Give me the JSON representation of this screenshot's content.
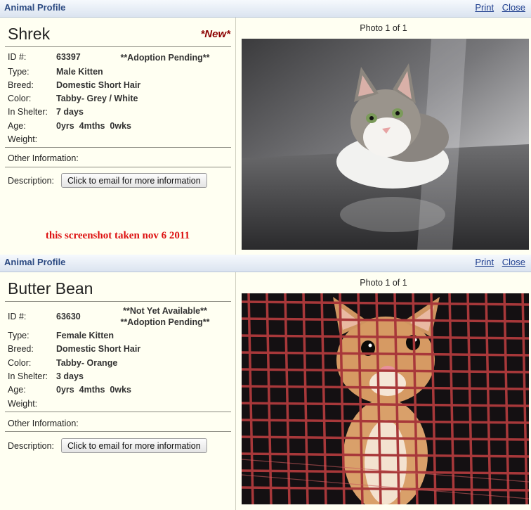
{
  "profiles": [
    {
      "bar": {
        "title": "Animal Profile",
        "print": "Print",
        "close": "Close"
      },
      "name": "Shrek",
      "new_tag": "*New*",
      "id_label": "ID #:",
      "id_value": "63397",
      "status_lines": [
        "**Adoption Pending**"
      ],
      "type_label": "Type:",
      "type_value": "Male Kitten",
      "breed_label": "Breed:",
      "breed_value": "Domestic Short Hair",
      "color_label": "Color:",
      "color_value": "Tabby- Grey / White",
      "shelter_label": "In Shelter:",
      "shelter_value": "7 days",
      "age_label": "Age:",
      "age_value": "0yrs  4mths  0wks",
      "weight_label": "Weight:",
      "weight_value": "",
      "other_label": "Other Information:",
      "desc_label": "Description:",
      "email_button": "Click to email for more information",
      "note": "this screenshot taken nov 6 2011",
      "photo_caption": "Photo 1 of 1"
    },
    {
      "bar": {
        "title": "Animal Profile",
        "print": "Print",
        "close": "Close"
      },
      "name": "Butter Bean",
      "id_label": "ID #:",
      "id_value": "63630",
      "status_lines": [
        "**Not Yet Available**",
        "**Adoption Pending**"
      ],
      "type_label": "Type:",
      "type_value": "Female Kitten",
      "breed_label": "Breed:",
      "breed_value": "Domestic Short Hair",
      "color_label": "Color:",
      "color_value": "Tabby- Orange",
      "shelter_label": "In Shelter:",
      "shelter_value": "3 days",
      "age_label": "Age:",
      "age_value": "0yrs  4mths  0wks",
      "weight_label": "Weight:",
      "weight_value": "",
      "other_label": "Other Information:",
      "desc_label": "Description:",
      "email_button": "Click to email for more information",
      "photo_caption": "Photo 1 of 1"
    }
  ],
  "colors": {
    "accent_new": "#8b0000",
    "note": "#dd1111",
    "link": "#1f3f8f",
    "panel_bg": "#fffff2"
  }
}
